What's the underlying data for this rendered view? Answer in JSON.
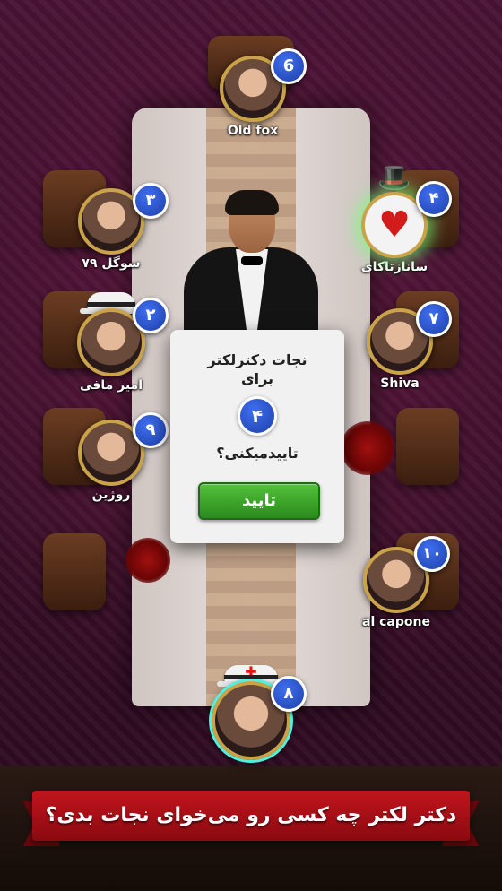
{
  "players": [
    {
      "id": "p6",
      "seat": "6",
      "name": "Old fox"
    },
    {
      "id": "p3",
      "seat": "۳",
      "name": "سوگل ۷۹"
    },
    {
      "id": "p4",
      "seat": "۴",
      "name": "سانازتاکای"
    },
    {
      "id": "p2",
      "seat": "۲",
      "name": "امیر مافی"
    },
    {
      "id": "p7",
      "seat": "۷",
      "name": "Shiva"
    },
    {
      "id": "p9",
      "seat": "۹",
      "name": "روژین"
    },
    {
      "id": "p10",
      "seat": "۱۰",
      "name": "al capone"
    },
    {
      "id": "p8",
      "seat": "۸",
      "name": ""
    }
  ],
  "dialog": {
    "line1": "نجات دکترلکتر",
    "line2": "برای",
    "target_number": "۴",
    "question": "تاییدمیکنی؟",
    "confirm_label": "تایید"
  },
  "banner": {
    "text": "دکتر لکتر چه کسی رو می‌خوای نجات بدی؟"
  },
  "colors": {
    "badge": "#2f55d4",
    "confirm": "#3aa52a",
    "banner": "#b3121a"
  }
}
